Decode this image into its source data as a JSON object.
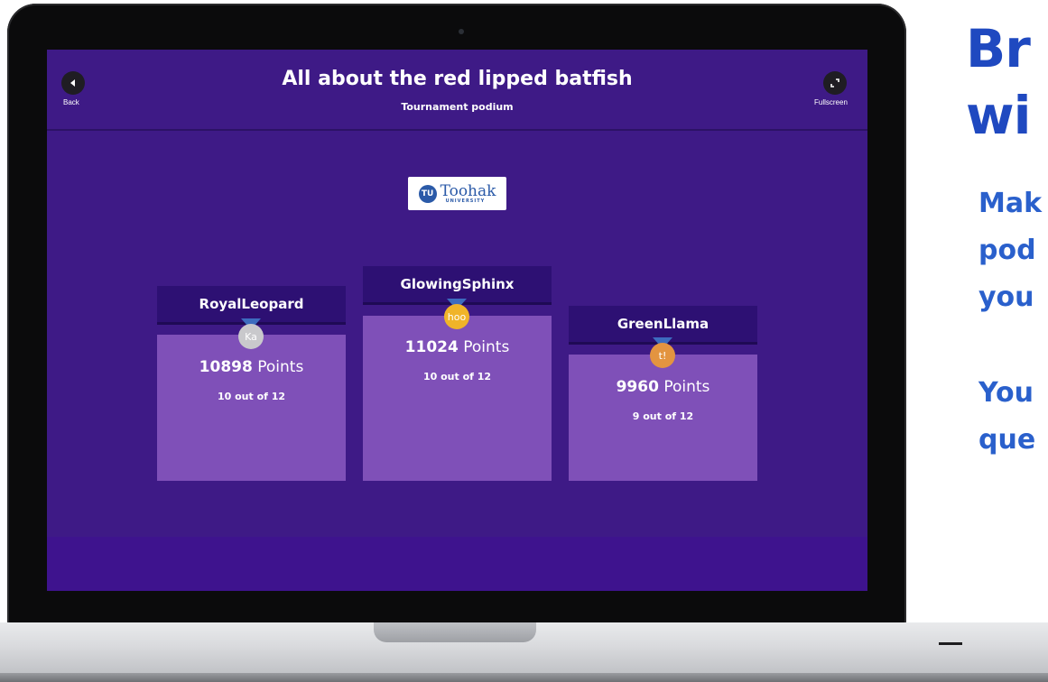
{
  "header": {
    "title": "All about the red lipped batfish",
    "subtitle": "Tournament podium",
    "back_label": "Back",
    "fullscreen_label": "Fullscreen"
  },
  "logo": {
    "mark": "TU",
    "name": "Toohak",
    "sub": "UNIVERSITY"
  },
  "podium": [
    {
      "place": 2,
      "name": "RoyalLeopard",
      "points": "10898",
      "points_unit": "Points",
      "score": "10 out of 12",
      "medal_text": "Ka",
      "medal_color": "#c9c9cc"
    },
    {
      "place": 1,
      "name": "GlowingSphinx",
      "points": "11024",
      "points_unit": "Points",
      "score": "10 out of 12",
      "medal_text": "hoo",
      "medal_color": "#f0b429"
    },
    {
      "place": 3,
      "name": "GreenLlama",
      "points": "9960",
      "points_unit": "Points",
      "score": "9 out of 12",
      "medal_text": "t!",
      "medal_color": "#e39440"
    }
  ],
  "promo": {
    "heading_line1": "Br",
    "heading_line2": "wi",
    "body_line1": "Mak",
    "body_line2": "pod",
    "body_line3": "you",
    "body_line4": "You",
    "body_line5": "que"
  },
  "colors": {
    "screen_bg": "#3e1a86",
    "podium_block": "#7f50b8",
    "name_bar": "#2d1073",
    "promo_blue": "#1f49c0"
  }
}
